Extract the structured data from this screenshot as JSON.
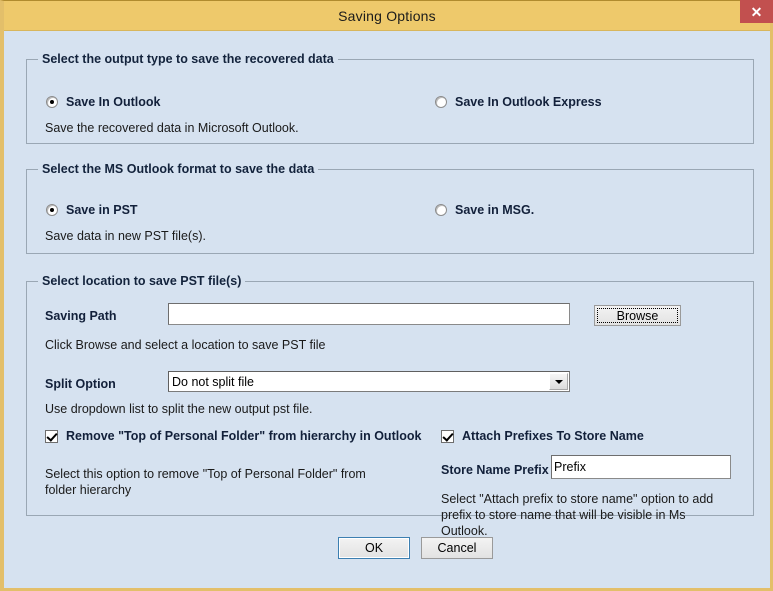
{
  "window": {
    "title": "Saving Options",
    "close_label": "✕",
    "accent_title_bg": "#eec96b",
    "close_bg": "#c2504f",
    "client_bg": "#d6e2f0"
  },
  "group_output_type": {
    "title": "Select the output type to save the recovered data",
    "options": [
      {
        "label": "Save In Outlook",
        "selected": true
      },
      {
        "label": "Save In Outlook Express",
        "selected": false
      }
    ],
    "help": "Save the recovered data in Microsoft Outlook."
  },
  "group_format": {
    "title": "Select the MS Outlook format to save the data",
    "options": [
      {
        "label": "Save in PST",
        "selected": true
      },
      {
        "label": "Save in MSG.",
        "selected": false
      }
    ],
    "help": "Save data in new PST file(s)."
  },
  "group_location": {
    "title": "Select location to save PST file(s)",
    "saving_path_label": "Saving Path",
    "saving_path_value": "",
    "saving_path_placeholder": "",
    "browse_label": "Browse",
    "browse_help": "Click Browse and select a location to save PST file",
    "split_option_label": "Split Option",
    "split_option_value": "Do not split file",
    "split_option_help": "Use dropdown list to split the new output pst file.",
    "remove_top_folder": {
      "label": "Remove \"Top of Personal Folder\" from hierarchy in Outlook",
      "checked": true,
      "help": "Select this option to remove \"Top of Personal Folder\" from folder hierarchy"
    },
    "attach_prefixes": {
      "label": "Attach Prefixes To Store Name",
      "checked": true,
      "help": "Select \"Attach prefix to store name\" option to add prefix to store name that will be visible in Ms Outlook."
    },
    "store_name_prefix_label": "Store Name Prefix",
    "store_name_prefix_value": "Prefix"
  },
  "footer": {
    "ok_label": "OK",
    "cancel_label": "Cancel"
  }
}
